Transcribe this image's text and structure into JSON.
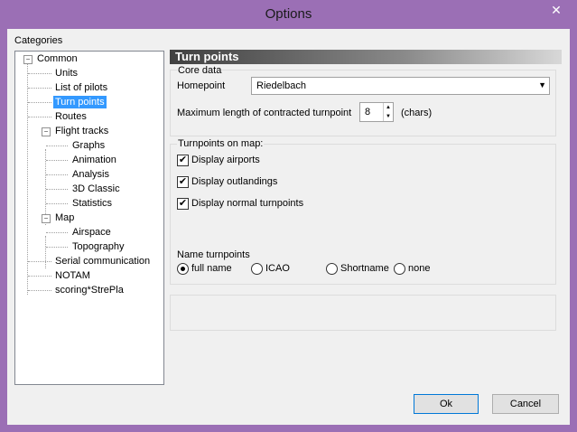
{
  "window": {
    "title": "Options",
    "close_glyph": "✕"
  },
  "categories_label": "Categories",
  "tree": {
    "common": "Common",
    "units": "Units",
    "list_of_pilots": "List of pilots",
    "turn_points": "Turn points",
    "routes": "Routes",
    "flight_tracks": "Flight tracks",
    "graphs": "Graphs",
    "animation": "Animation",
    "analysis": "Analysis",
    "classic_3d": "3D Classic",
    "statistics": "Statistics",
    "map": "Map",
    "airspace": "Airspace",
    "topography": "Topography",
    "serial_communication": "Serial communication",
    "notam": "NOTAM",
    "scoring": "scoring*StrePla",
    "expander_glyph": "−"
  },
  "panel": {
    "header": "Turn points",
    "core_data": {
      "title": "Core data",
      "homepoint_label": "Homepoint",
      "homepoint_value": "Riedelbach",
      "maxlen_label": "Maximum length of contracted turnpoint",
      "maxlen_value": "8",
      "maxlen_unit": "(chars)"
    },
    "turnpoints_on_map": {
      "title": "Turnpoints on map:",
      "display_airports": "Display airports",
      "display_outlandings": "Display outlandings",
      "display_normal": "Display normal turnpoints",
      "check_glyph": "✔",
      "name_label": "Name turnpoints",
      "opt_full_name": "full name",
      "opt_icao": "ICAO",
      "opt_shortname": "Shortname",
      "opt_none": "none"
    }
  },
  "buttons": {
    "ok": "Ok",
    "cancel": "Cancel"
  }
}
